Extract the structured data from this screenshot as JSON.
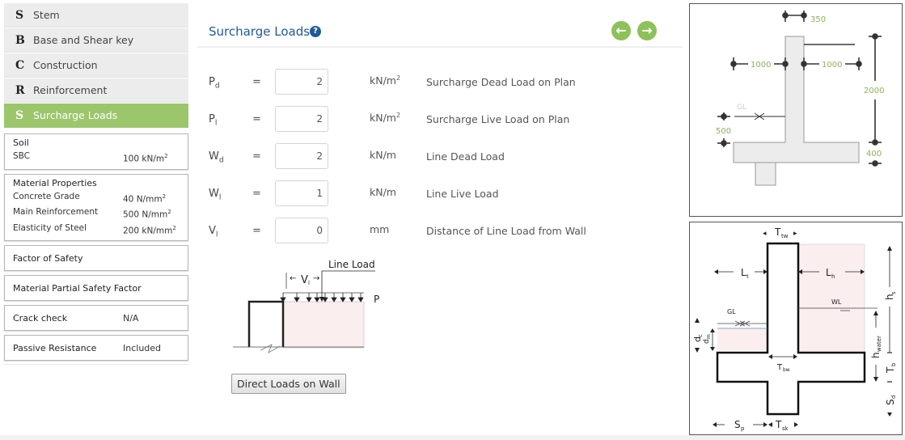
{
  "sidebar": {
    "nav": [
      {
        "letter": "S",
        "label": "Stem",
        "active": false
      },
      {
        "letter": "B",
        "label": "Base and Shear key",
        "active": false
      },
      {
        "letter": "C",
        "label": "Construction",
        "active": false
      },
      {
        "letter": "R",
        "label": "Reinforcement",
        "active": false
      },
      {
        "letter": "S",
        "label": "Surcharge Loads",
        "active": true
      }
    ],
    "soil": {
      "title": "Soil",
      "rows": [
        {
          "key": "SBC",
          "value": "100 kN/m",
          "sup": "2"
        }
      ]
    },
    "material": {
      "title": "Material Properties",
      "rows": [
        {
          "key": "Concrete Grade",
          "value": "40 N/mm",
          "sup": "2"
        },
        {
          "key": "Main Reinforcement",
          "value": "500 N/mm",
          "sup": "2"
        },
        {
          "key": "Elasticity of Steel",
          "value": "200 kN/mm",
          "sup": "2"
        }
      ]
    },
    "factor_of_safety": "Factor of Safety",
    "material_partial": "Material Partial Safety Factor",
    "crack_check": {
      "key": "Crack check",
      "value": "N/A"
    },
    "passive_resistance": {
      "key": "Passive Resistance",
      "value": "Included"
    }
  },
  "main": {
    "title": "Surcharge Loads",
    "help_icon": "?",
    "prev_icon": "←",
    "next_icon": "→",
    "fields": [
      {
        "sym": "P",
        "sub": "d",
        "eq": "=",
        "value": "2",
        "unit": "kN/m",
        "unit_sup": "2",
        "desc": "Surcharge Dead Load on Plan"
      },
      {
        "sym": "P",
        "sub": "l",
        "eq": "=",
        "value": "2",
        "unit": "kN/m",
        "unit_sup": "2",
        "desc": "Surcharge Live Load on Plan"
      },
      {
        "sym": "W",
        "sub": "d",
        "eq": "=",
        "value": "2",
        "unit": "kN/m",
        "unit_sup": "",
        "desc": "Line Dead Load"
      },
      {
        "sym": "W",
        "sub": "l",
        "eq": "=",
        "value": "1",
        "unit": "kN/m",
        "unit_sup": "",
        "desc": "Line Live Load"
      },
      {
        "sym": "V",
        "sub": "l",
        "eq": "=",
        "value": "0",
        "unit": "mm",
        "unit_sup": "",
        "desc": "Distance of Line Load from Wall"
      }
    ],
    "diagram": {
      "line_load": "Line Load",
      "vl": "V",
      "vl_sub": "l",
      "p": "P"
    },
    "direct_loads_button": "Direct Loads on Wall"
  },
  "top_diagram": {
    "stem_thickness": "350",
    "toe_length": "1000",
    "heel_length": "1000",
    "stem_height": "2000",
    "gl_depth": "500",
    "base_thickness": "400",
    "gl_label": "GL",
    "colors": {
      "dimension": "#8db05c",
      "concrete": "#ececec"
    }
  },
  "bottom_diagram": {
    "t_tw": "T",
    "t_tw_sub": "tw",
    "l_t": "L",
    "l_t_sub": "t",
    "l_h": "L",
    "l_h_sub": "h",
    "h_s": "h",
    "h_s_sub": "s",
    "wl": "WL",
    "gl": "GL",
    "d_c": "d",
    "d_c_sub": "c",
    "d_m": "d",
    "d_m_sub": "m",
    "h_water": "h",
    "h_water_sub": "water",
    "t_bw": "T",
    "t_bw_sub": "bw",
    "t_b": "T",
    "t_b_sub": "b",
    "s_d": "S",
    "s_d_sub": "d",
    "s_p": "S",
    "s_p_sub": "p",
    "t_sk": "T",
    "t_sk_sub": "sk",
    "colors": {
      "soil_fill": "#fbeeee"
    }
  },
  "colors": {
    "accent_green": "#9cc66b",
    "title_blue": "#1f5a96"
  }
}
